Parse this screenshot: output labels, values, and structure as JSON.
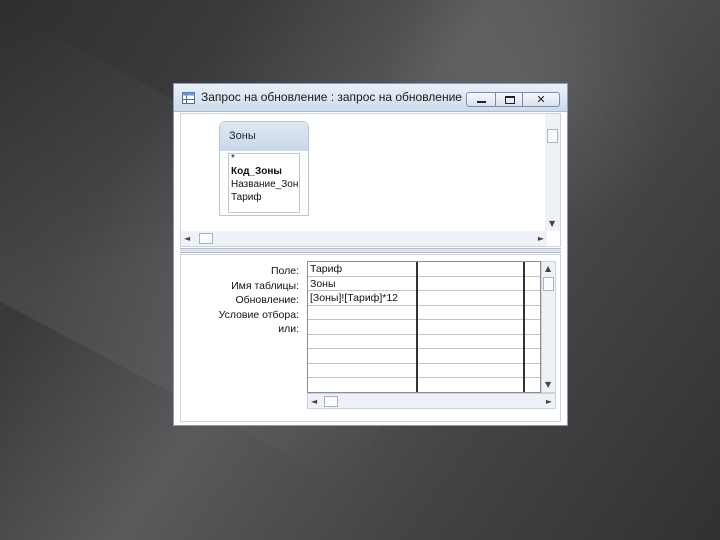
{
  "window": {
    "title": "Запрос на обновление : запрос на обновление",
    "buttons": {
      "minimize": "minimize",
      "maximize": "maximize",
      "close": "✕"
    }
  },
  "table_box": {
    "title": "Зоны",
    "fields": [
      "*",
      "Код_Зоны",
      "Название_Зоны",
      "Тариф"
    ]
  },
  "grid": {
    "row_labels": [
      "Поле:",
      "Имя таблицы:",
      "Обновление:",
      "Условие отбора:",
      "или:"
    ],
    "columns": [
      {
        "field": "Тариф",
        "table": "Зоны",
        "update": "[Зоны]![Тариф]*12",
        "criteria": "",
        "or": ""
      },
      {
        "field": "",
        "table": "",
        "update": "",
        "criteria": "",
        "or": ""
      },
      {
        "field": "",
        "table": "",
        "update": "",
        "criteria": "",
        "or": ""
      }
    ]
  },
  "scroll": {
    "up": "▲",
    "down": "▼",
    "left": "◄",
    "right": "►"
  }
}
